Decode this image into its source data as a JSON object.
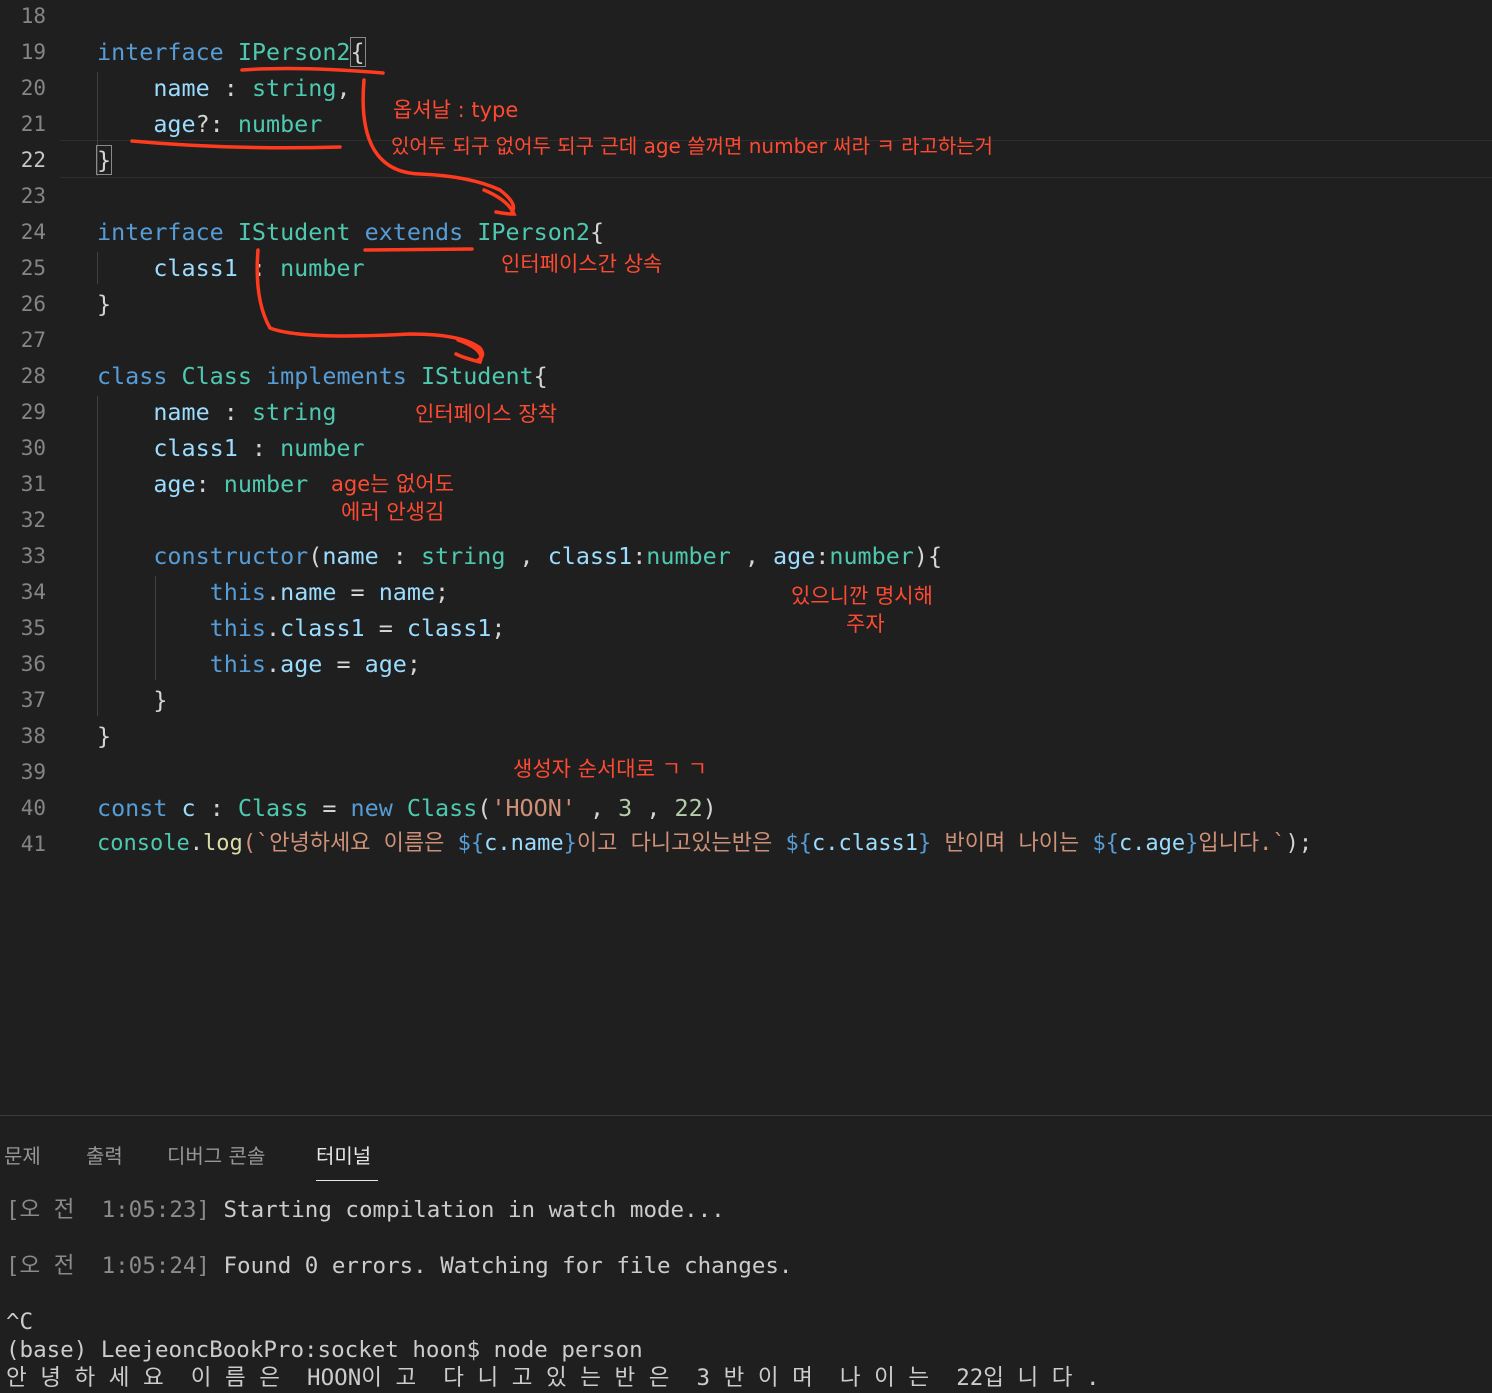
{
  "editor": {
    "line_numbers": [
      "18",
      "19",
      "20",
      "21",
      "22",
      "23",
      "24",
      "25",
      "26",
      "27",
      "28",
      "29",
      "30",
      "31",
      "32",
      "33",
      "34",
      "35",
      "36",
      "37",
      "38",
      "39",
      "40",
      "41"
    ],
    "current_line": "22",
    "code": {
      "l19": {
        "kw": "interface",
        "name": "IPerson2",
        "brace": "{"
      },
      "l20": {
        "prop": "name",
        "sep": " : ",
        "type": "string",
        "end": ","
      },
      "l21": {
        "prop": "age",
        "opt": "?: ",
        "type": "number"
      },
      "l22": {
        "brace": "}"
      },
      "l24": {
        "kw": "interface",
        "name": "IStudent",
        "ext": "extends",
        "base": "IPerson2",
        "brace": "{"
      },
      "l25": {
        "prop": "class1",
        "sep": " : ",
        "type": "number"
      },
      "l26": {
        "brace": "}"
      },
      "l28": {
        "kw": "class",
        "name": "Class",
        "impl": "implements",
        "iface": "IStudent",
        "brace": "{"
      },
      "l29": {
        "prop": "name",
        "sep": " : ",
        "type": "string"
      },
      "l30": {
        "prop": "class1",
        "sep": " : ",
        "type": "number"
      },
      "l31": {
        "prop": "age",
        "sep": ": ",
        "type": "number"
      },
      "l33": {
        "ctor": "constructor",
        "p1": "name",
        "s1": " : ",
        "t1": "string",
        "c1": " , ",
        "p2": "class1",
        "s2": ":",
        "t2": "number",
        "c2": " , ",
        "p3": "age",
        "s3": ":",
        "t3": "number",
        "end": "){"
      },
      "l34": {
        "this": "this",
        "dot": ".",
        "prop": "name",
        "eq": " = ",
        "val": "name",
        "semi": ";"
      },
      "l35": {
        "this": "this",
        "dot": ".",
        "prop": "class1",
        "eq": " = ",
        "val": "class1",
        "semi": ";"
      },
      "l36": {
        "this": "this",
        "dot": ".",
        "prop": "age",
        "eq": " = ",
        "val": "age",
        "semi": ";"
      },
      "l37": {
        "brace": "}"
      },
      "l38": {
        "brace": "}"
      },
      "l40": {
        "kw": "const",
        "var": "c",
        "sep": " : ",
        "type": "Class",
        "eq": " = ",
        "new": "new",
        "cls": "Class",
        "open": "(",
        "str": "'HOON'",
        "c1": " , ",
        "n1": "3",
        "c2": " , ",
        "n2": "22",
        "close": ")"
      },
      "l41": {
        "obj": "console",
        "dot": ".",
        "fn": "log",
        "open": "(`",
        "t1": "안녕하세요 이름은 ",
        "e1o": "${",
        "e1": "c.name",
        "e1c": "}",
        "t2": "이고 다니고있는반은 ",
        "e2o": "${",
        "e2": "c.class1",
        "e2c": "}",
        "t3": " 반이며 나이는 ",
        "e3o": "${",
        "e3": "c.age",
        "e3c": "}",
        "t4": "입니다.`",
        "close": ");"
      }
    }
  },
  "annotations": {
    "a1": "옵셔날 : type",
    "a2": "있어두 되구 없어두 되구 근데 age 쓸꺼면 number 써라 ㅋ 라고하는거",
    "a3": "인터페이스간 상속",
    "a4": "인터페이스 장착",
    "a5": "age는 없어도",
    "a6": "에러 안생김",
    "a7": "있으니깐 명시해",
    "a8": "주자",
    "a9": "생성자 순서대로 ㄱ ㄱ"
  },
  "panel": {
    "tabs": [
      "문제",
      "출력",
      "디버그 콘솔",
      "터미널"
    ],
    "active_tab": "터미널",
    "terminal": {
      "l1_prefix": "[오 전  1:05:23]",
      "l1_text": " Starting compilation in watch mode...",
      "l2_prefix": "[오 전  1:05:24]",
      "l2_text": " Found 0 errors. Watching for file changes.",
      "l3": "^C",
      "l4": "(base) LeejeoncBookPro:socket hoon$ node person",
      "l5": "안 녕 하 세 요  이 름 은  HOON이 고  다 니 고 있 는 반 은  3 반 이 며  나 이 는  22입 니 다 ."
    }
  },
  "colors": {
    "annotation": "#ff4a32",
    "keyword": "#569cd6",
    "type": "#4ec9b0",
    "property": "#9cdcfe"
  }
}
